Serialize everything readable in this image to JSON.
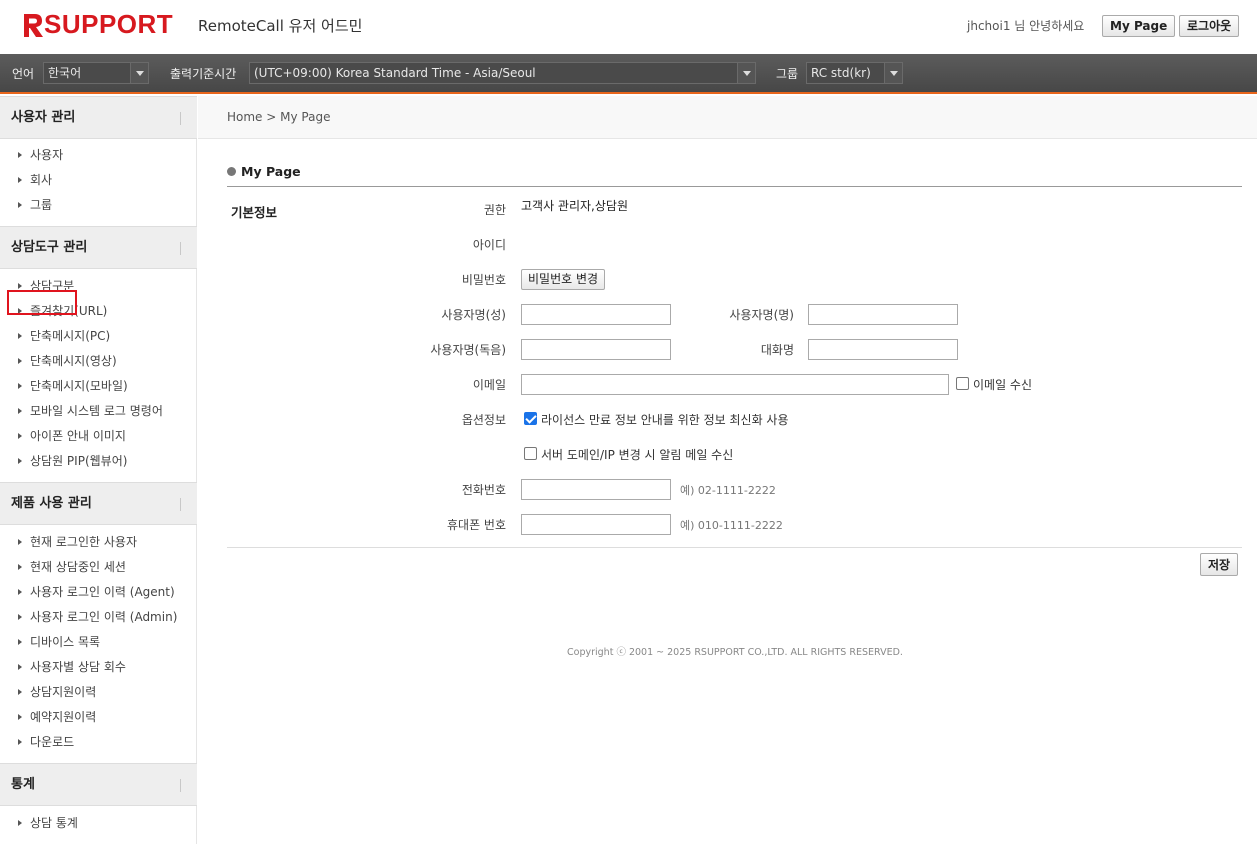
{
  "header": {
    "logo_text": "SUPPORT",
    "app_title": "RemoteCall 유저 어드민",
    "greeting": "jhchoi1 님 안녕하세요",
    "mypage_label": "My Page",
    "logout_label": "로그아웃"
  },
  "filters": {
    "language_label": "언어",
    "language_value": "한국어",
    "timezone_label": "출력기준시간",
    "timezone_value": "(UTC+09:00) Korea Standard Time - Asia/Seoul",
    "group_label": "그룹",
    "group_value": "RC std(kr)"
  },
  "sidebar": {
    "sections": [
      {
        "title": "사용자 관리",
        "items": [
          "사용자",
          "회사",
          "그룹"
        ]
      },
      {
        "title": "상담도구 관리",
        "items": [
          "상담구분",
          "즐겨찾기(URL)",
          "단축메시지(PC)",
          "단축메시지(영상)",
          "단축메시지(모바일)",
          "모바일 시스템 로그 명령어",
          "아이폰 안내 이미지",
          "상담원 PIP(웹뷰어)"
        ]
      },
      {
        "title": "제품 사용 관리",
        "items": [
          "현재 로그인한 사용자",
          "현재 상담중인 세션",
          "사용자 로그인 이력 (Agent)",
          "사용자 로그인 이력 (Admin)",
          "디바이스 목록",
          "사용자별 상담 회수",
          "상담지원이력",
          "예약지원이력",
          "다운로드"
        ]
      },
      {
        "title": "통계",
        "items": [
          "상담 통계"
        ]
      }
    ]
  },
  "breadcrumb": {
    "home": "Home",
    "separator": ">",
    "current": "My Page"
  },
  "page": {
    "title": "My Page",
    "basic_info_label": "기본정보",
    "permission_label": "권한",
    "permission_value": "고객사 관리자,상담원",
    "id_label": "아이디",
    "id_value": "",
    "password_label": "비밀번호",
    "password_button": "비밀번호 변경",
    "lastname_label": "사용자명(성)",
    "firstname_label": "사용자명(명)",
    "reading_label": "사용자명(독음)",
    "nickname_label": "대화명",
    "email_label": "이메일",
    "email_receive_label": "이메일 수신",
    "options_label": "옵션정보",
    "option1_label": "라이선스 만료 정보 안내를 위한 정보 최신화 사용",
    "option2_label": "서버 도메인/IP 변경 시 알림 메일 수신",
    "phone_label": "전화번호",
    "phone_hint": "예) 02-1111-2222",
    "mobile_label": "휴대폰 번호",
    "mobile_hint": "예) 010-1111-2222",
    "save_label": "저장"
  },
  "footer": {
    "copyright": "Copyright ⓒ 2001 ~ 2025 RSUPPORT CO.,LTD. ALL RIGHTS RESERVED."
  },
  "colors": {
    "brand": "#d7191f",
    "accent": "#e8651b",
    "highlight": "#e0141e"
  }
}
